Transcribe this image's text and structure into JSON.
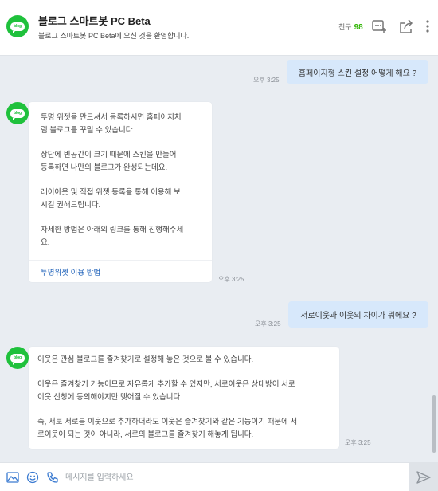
{
  "header": {
    "avatar_text": "blog",
    "title": "블로그 스마트봇 PC Beta",
    "subtitle": "블로그 스마트봇 PC Beta에 오신 것을 환영합니다.",
    "friends_label": "친구",
    "friends_count": "98",
    "icons": [
      "add-friend-icon",
      "share-icon",
      "more-vertical-icon"
    ]
  },
  "messages": [
    {
      "from": "me",
      "text": "홈페이지형 스킨 설정 어떻게 해요 ?",
      "time": "오후 3:25"
    },
    {
      "from": "bot",
      "avatar_text": "blog",
      "paragraphs": [
        "투명 위젯을 만드셔서 등록하시면 홈페이지처\n럼 블로그를 꾸밀 수 있습니다.",
        "상단에 빈공간이 크기 때문에 스킨을 만들어\n등록하면 나만의 블로그가 완성되는데요.",
        "레이아웃 및 직접 위젯 등록을 통해 이용해 보\n시길 권해드립니다.",
        "자세한 방법은 아래의 링크를 통해 진행해주세\n요."
      ],
      "link": "투명위젯 이용 방법",
      "time": "오후 3:25"
    },
    {
      "from": "me",
      "text": "서로이웃과 이웃의 차이가 뭐에요 ?",
      "time": "오후 3:25"
    },
    {
      "from": "bot",
      "avatar_text": "blog",
      "paragraphs": [
        "이웃은 관심 블로그를 즐겨찾기로 설정해 놓은 것으로 볼 수 있습니다.",
        "이웃은 즐겨찾기 기능이므로 자유롭게 추가할 수 있지만, 서로이웃은 상대방이 서로\n이웃 신청에 동의해야지만 맺어질 수 있습니다.",
        "즉, 서로 서로를 이웃으로 추가하더라도 이웃은 즐겨찾기와 같은 기능이기 때문에 서\n로이웃이 되는 것이 아니라, 서로의 블로그를 즐겨찾기 해놓게 됩니다."
      ],
      "time": "오후 3:25"
    }
  ],
  "input": {
    "placeholder": "메시지를 입력하세요",
    "icons": [
      "image-icon",
      "emoji-icon",
      "phone-icon",
      "send-icon"
    ]
  },
  "colors": {
    "background": "#e9edf2",
    "my_bubble": "#d7e8fb",
    "brand_green": "#1fc13c",
    "link_blue": "#1b5fb8"
  }
}
